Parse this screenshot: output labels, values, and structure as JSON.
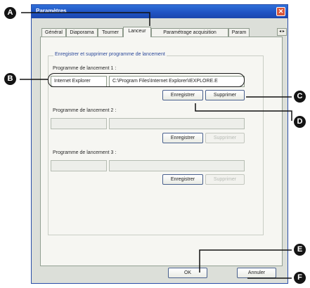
{
  "window": {
    "title": "Paramètres"
  },
  "tabs": [
    {
      "label": "Général"
    },
    {
      "label": "Diaporama"
    },
    {
      "label": "Tourner"
    },
    {
      "label": "Lanceur"
    },
    {
      "label": "Paramétrage acquisition"
    },
    {
      "label": "Param"
    }
  ],
  "group": {
    "title": "Enregistrer et supprimer programme de lancement",
    "launchers": [
      {
        "label": "Programme de lancement 1 :",
        "name": "Internet Explorer",
        "path": "C:\\Program Files\\Internet Explorer\\IEXPLORE.E",
        "save": "Enregistrer",
        "delete": "Supprimer"
      },
      {
        "label": "Programme de lancement 2 :",
        "name": "",
        "path": "",
        "save": "Enregistrer",
        "delete": "Supprimer"
      },
      {
        "label": "Programme de lancement 3 :",
        "name": "",
        "path": "",
        "save": "Enregistrer",
        "delete": "Supprimer"
      }
    ]
  },
  "footer": {
    "ok": "OK",
    "cancel": "Annuler"
  },
  "callouts": [
    "A",
    "B",
    "C",
    "D",
    "E",
    "F"
  ]
}
